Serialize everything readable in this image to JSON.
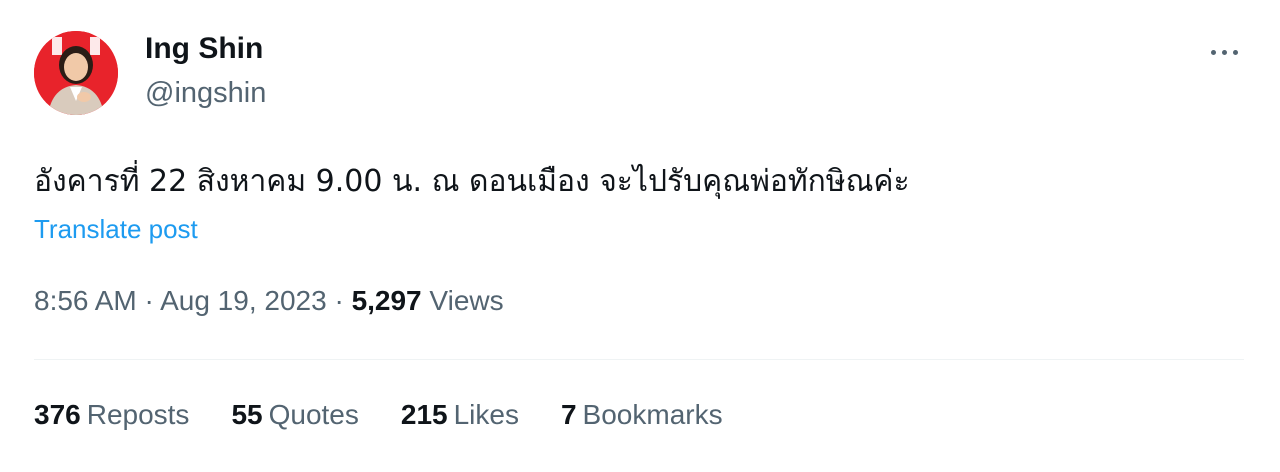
{
  "tweet": {
    "display_name": "Ing Shin",
    "handle": "@ingshin",
    "text": "อังคารที่ 22 สิงหาคม 9.00 น. ณ ดอนเมือง จะไปรับคุณพ่อทักษิณค่ะ",
    "translate_label": "Translate post",
    "time": "8:56 AM",
    "date": "Aug 19, 2023",
    "separator": "·",
    "views_count": "5,297",
    "views_label": "Views",
    "more_icon": "more-horizontal-icon"
  },
  "stats": {
    "reposts": {
      "count": "376",
      "label": "Reposts"
    },
    "quotes": {
      "count": "55",
      "label": "Quotes"
    },
    "likes": {
      "count": "215",
      "label": "Likes"
    },
    "bookmarks": {
      "count": "7",
      "label": "Bookmarks"
    }
  },
  "colors": {
    "text_primary": "#0f1419",
    "text_secondary": "#536471",
    "link": "#1d9bf0",
    "divider": "#eff3f4",
    "avatar_bg": "#e8232b"
  }
}
